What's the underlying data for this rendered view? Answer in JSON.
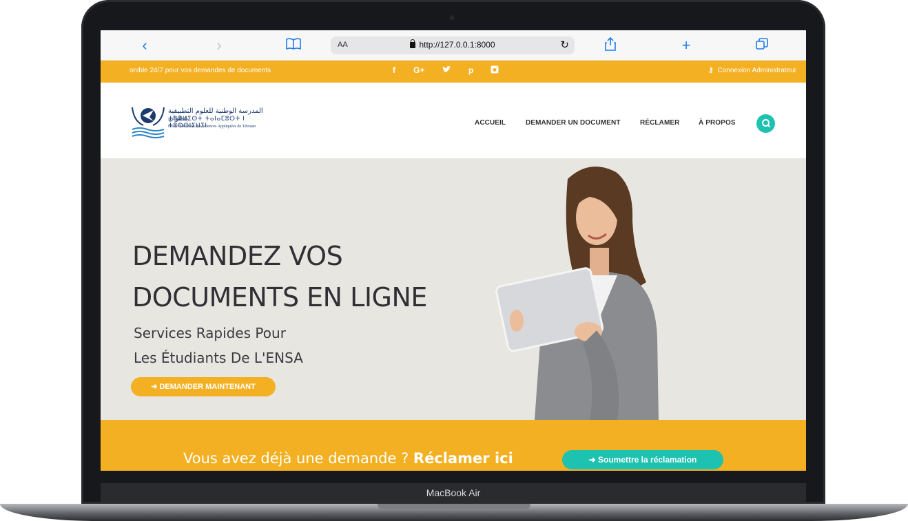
{
  "device": {
    "label": "MacBook Air"
  },
  "browser": {
    "reader_label": "AA",
    "url": "http://127.0.0.1:8000",
    "back_icon": "chevron-left-icon",
    "forward_icon": "chevron-right-icon",
    "bookmarks_icon": "book-icon",
    "reload_icon": "reload-icon",
    "share_icon": "share-icon",
    "new_tab_icon": "plus-icon",
    "tabs_icon": "tabs-icon"
  },
  "topbar": {
    "notice": "onible 24/7 pour vos demandes de documents",
    "social": [
      "f",
      "G+",
      "t",
      "p",
      "i"
    ],
    "admin_label": "Connexion Administrateur"
  },
  "header": {
    "logo_arabic": "المدرسة الوطنية للعلوم التطبيقية بتطوان",
    "logo_tifinagh": "ⵜⵓⵍⵍⵉⵙⵜ ⵜⴰⵏⴰⵎⵓⵔⵜ ⵏ ⵜⵓⵙⵙⵏⵉⵡⵉⵏ",
    "logo_french": "Ecole Nationale des Sciences Appliquées de Tétouan",
    "nav": [
      "ACCUEIL",
      "DEMANDER UN DOCUMENT",
      "RÉCLAMER",
      "À PROPOS"
    ],
    "search_icon": "search-icon"
  },
  "hero": {
    "title_line1": "DEMANDEZ VOS",
    "title_line2": "DOCUMENTS EN LIGNE",
    "subtitle_line1": "Services Rapides Pour",
    "subtitle_line2": "Les Étudiants De L'ENSA",
    "button_label": "DEMANDER MAINTENANT"
  },
  "cta": {
    "text": "Vous avez déjà une demande ?",
    "strong": "Réclamer ici",
    "button_label": "Soumettre la réclamation"
  },
  "colors": {
    "accent": "#f4b023",
    "teal": "#1ec2b0",
    "hero_bg": "#e8e6e1"
  }
}
